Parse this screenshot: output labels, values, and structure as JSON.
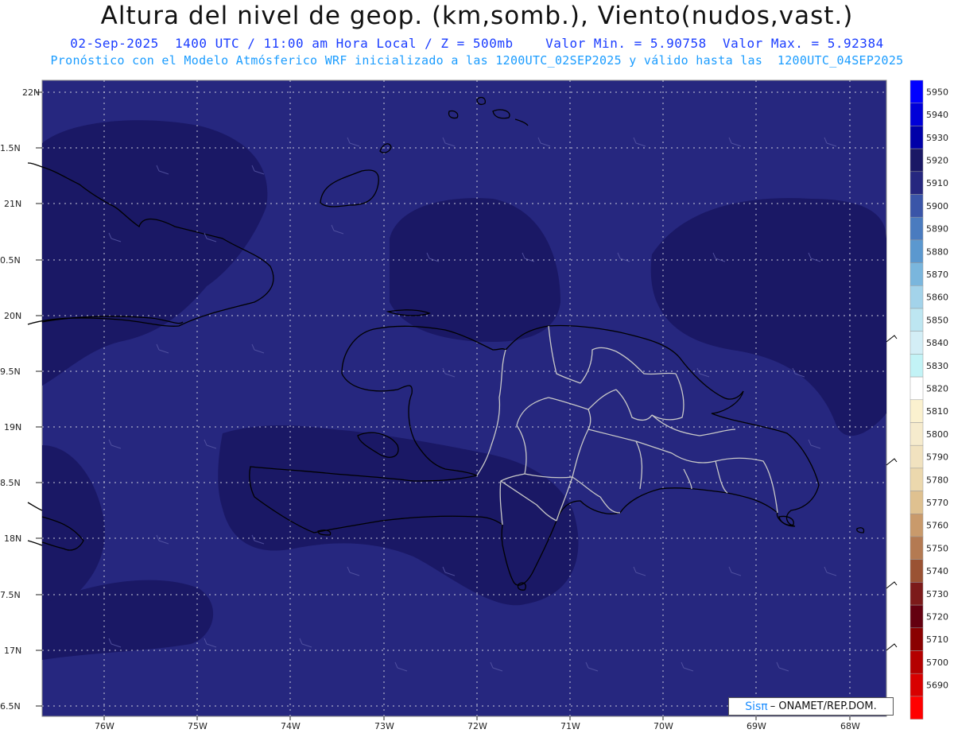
{
  "header": {
    "title": "Altura del nivel de geop. (km,somb.), Viento(nudos,vast.)",
    "subtitle_left": "02-Sep-2025  1400 UTC / 11:00 am Hora Local / Z = 500mb",
    "subtitle_right": "Valor Min. = 5.90758  Valor Max. = 5.92384",
    "model_line": "Pronóstico con el Modelo Atmósferico WRF inicializado a las 1200UTC_02SEP2025 y válido hasta las  1200UTC_04SEP2025"
  },
  "map": {
    "lat_labels": [
      "22N",
      "1.5N",
      "21N",
      "0.5N",
      "20N",
      "9.5N",
      "19N",
      "8.5N",
      "18N",
      "7.5N",
      "17N",
      "6.5N"
    ],
    "lon_labels": [
      "76W",
      "75W",
      "74W",
      "73W",
      "72W",
      "71W",
      "70W",
      "69W",
      "68W"
    ],
    "ocean_color": "#26277f",
    "high_color": "#1a1865",
    "coast_color": "#000000",
    "border_color": "#c8c8c8"
  },
  "colorbar": {
    "levels": [
      {
        "value": "5950",
        "color": "#0000ff"
      },
      {
        "value": "5940",
        "color": "#0000d8"
      },
      {
        "value": "5930",
        "color": "#0000a8"
      },
      {
        "value": "5920",
        "color": "#1a1865"
      },
      {
        "value": "5910",
        "color": "#26277f"
      },
      {
        "value": "5900",
        "color": "#3a55a8"
      },
      {
        "value": "5890",
        "color": "#4a7bbf"
      },
      {
        "value": "5880",
        "color": "#5b98cf"
      },
      {
        "value": "5870",
        "color": "#7ab6dd"
      },
      {
        "value": "5860",
        "color": "#a3d3ea"
      },
      {
        "value": "5850",
        "color": "#bde6f1"
      },
      {
        "value": "5840",
        "color": "#d3eef6"
      },
      {
        "value": "5830",
        "color": "#c2f3f6"
      },
      {
        "value": "5820",
        "color": "#ffffff"
      },
      {
        "value": "5810",
        "color": "#fbf1cf"
      },
      {
        "value": "5800",
        "color": "#f6ebcd"
      },
      {
        "value": "5790",
        "color": "#f1e2bf"
      },
      {
        "value": "5780",
        "color": "#ecd8ad"
      },
      {
        "value": "5770",
        "color": "#dfc190"
      },
      {
        "value": "5760",
        "color": "#c99a6b"
      },
      {
        "value": "5750",
        "color": "#b47a52"
      },
      {
        "value": "5740",
        "color": "#9a5233"
      },
      {
        "value": "5730",
        "color": "#7c1a1a"
      },
      {
        "value": "5720",
        "color": "#640010"
      },
      {
        "value": "5710",
        "color": "#8a0000"
      },
      {
        "value": "5700",
        "color": "#b40000"
      },
      {
        "value": "5690",
        "color": "#d80000"
      },
      {
        "value": "",
        "color": "#ff0000"
      }
    ]
  },
  "credit": {
    "brand": "Sisπ",
    "text": "– ONAMET/REP.DOM."
  }
}
